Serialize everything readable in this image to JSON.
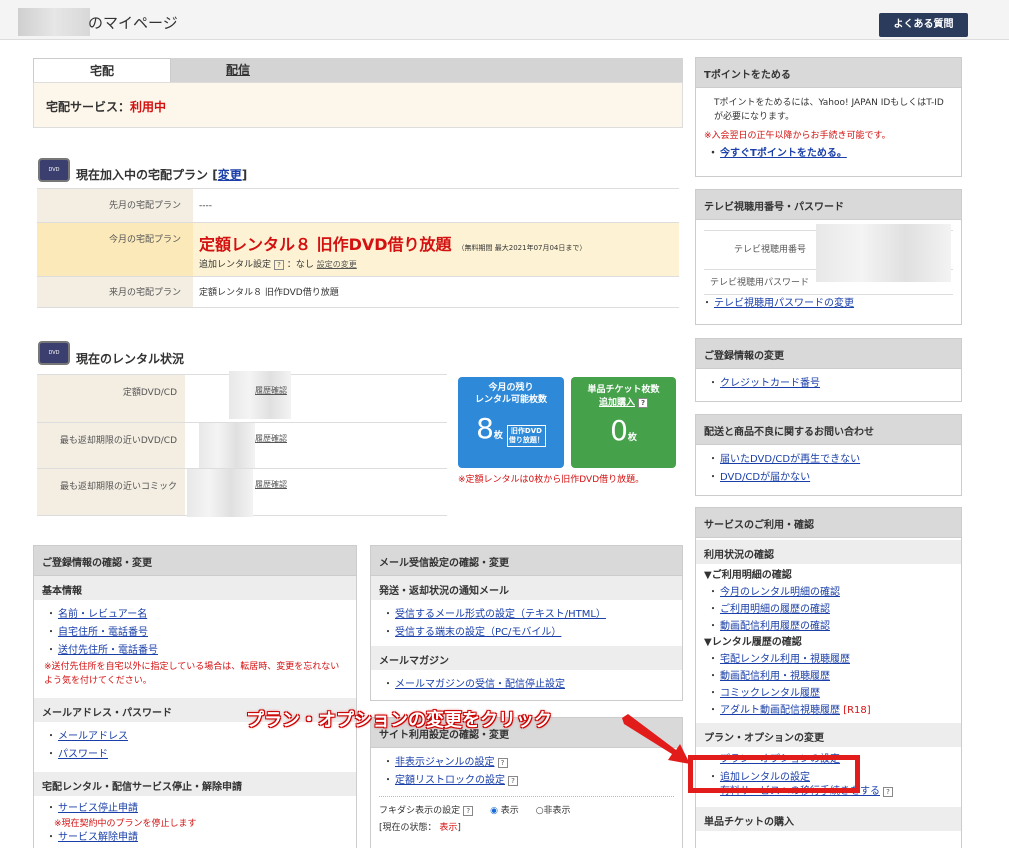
{
  "header": {
    "title": "のマイページ",
    "faq": "よくある質問"
  },
  "tabs": {
    "delivery": "宅配",
    "streaming": "配信"
  },
  "status": {
    "label": "宅配サービス：",
    "value": "利用中"
  },
  "plan": {
    "title": "現在加入中の宅配プラン",
    "change": "変更",
    "last_label": "先月の宅配プラン",
    "last_value": "----",
    "this_label": "今月の宅配プラン",
    "this_value": "定額レンタル８ 旧作DVD借り放題",
    "this_note": "（無料期間 最大2021年07月04日まで）",
    "addon_label": "追加レンタル設定",
    "addon_value": "：なし",
    "addon_change": "設定の変更",
    "next_label": "来月の宅配プラン",
    "next_value": "定額レンタル８ 旧作DVD借り放題"
  },
  "rental": {
    "title": "現在のレンタル状況",
    "rows": [
      "定額DVD/CD",
      "最も返却期限の近いDVD/CD",
      "最も返却期限の近いコミック"
    ],
    "hist": "履歴確認",
    "remain_title": "今月の残り\nレンタル可能枚数",
    "remain_count": "8",
    "remain_unit": "枚",
    "remain_badge": "旧作DVD\n借り放題！",
    "ticket_title": "単品チケット枚数",
    "ticket_buy": "追加購入",
    "ticket_count": "0",
    "ticket_unit": "枚",
    "note": "※定額レンタルは0枚から旧作DVD借り放題。"
  },
  "reg": {
    "title": "ご登録情報の確認・変更",
    "basic": "基本情報",
    "links1": [
      "名前・レビュアー名",
      "自宅住所・電話番号",
      "送付先住所・電話番号"
    ],
    "note1": "※送付先住所を自宅以外に指定している場合は、転居時、変更を忘れないよう気を付けてください。",
    "mail_head": "メールアドレス・パスワード",
    "links2": [
      "メールアドレス",
      "パスワード"
    ],
    "stop_head": "宅配レンタル・配信サービス停止・解除申請",
    "links3": [
      "サービス停止申請",
      "サービス解除申請"
    ],
    "note3": "※現在契約中のプランを停止します"
  },
  "mail": {
    "title": "メール受信設定の確認・変更",
    "sub1": "発送・返却状況の通知メール",
    "links1": [
      "受信するメール形式の設定（テキスト/HTML）",
      "受信する端末の設定（PC/モバイル）"
    ],
    "sub2": "メールマガジン",
    "links2": [
      "メールマガジンの受信・配信停止設定"
    ]
  },
  "site": {
    "title": "サイト利用設定の確認・変更",
    "links": [
      "非表示ジャンルの設定",
      "定額リストロックの設定"
    ],
    "fukidashi": "フキダシ表示の設定",
    "opt_show": "表示",
    "opt_hide": "非表示",
    "current": "[現在の状態：",
    "current_val": "表示",
    "current_end": "]"
  },
  "tpoint": {
    "title": "Tポイントをためる",
    "text": "Tポイントをためるには、Yahoo! JAPAN IDもしくはT-IDが必要になります。",
    "note": "※入会翌日の正午以降からお手続き可能です。",
    "link": "今すぐTポイントをためる。"
  },
  "tv": {
    "title": "テレビ視聴用番号・パスワード",
    "num": "テレビ視聴用番号",
    "pw": "テレビ視聴用パスワード",
    "link": "テレビ視聴用パスワードの変更"
  },
  "regchange": {
    "title": "ご登録情報の変更",
    "link": "クレジットカード番号"
  },
  "inquiry": {
    "title": "配送と商品不良に関するお問い合わせ",
    "links": [
      "届いたDVD/CDが再生できない",
      "DVD/CDが届かない"
    ]
  },
  "service": {
    "title": "サービスのご利用・確認",
    "sub1": "利用状況の確認",
    "g1": "▼ご利用明細の確認",
    "g1links": [
      "今月のレンタル明細の確認",
      "ご利用明細の履歴の確認",
      "動画配信利用履歴の確認"
    ],
    "g2": "▼レンタル履歴の確認",
    "g2links": [
      "宅配レンタル利用・視聴履歴",
      "動画配信利用・視聴履歴",
      "コミックレンタル履歴",
      "アダルト動画配信視聴履歴"
    ],
    "r18": "[R18]",
    "sub2": "プラン・オプションの変更",
    "plan_link": "プラン・オプションの設定",
    "hidden_link": "追加レンタルの設定",
    "paid_link": "有料サービスへの移行手続きをする",
    "sub3": "単品チケットの購入"
  },
  "annotation": "プラン・オプションの変更をクリック"
}
